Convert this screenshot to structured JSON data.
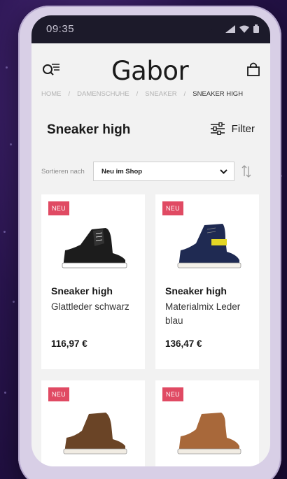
{
  "status_bar": {
    "time": "09:35"
  },
  "header": {
    "logo": "Gabor",
    "menu_icon": "search-menu-icon",
    "cart_icon": "shopping-bag-icon"
  },
  "breadcrumb": [
    "HOME",
    "DAMENSCHUHE",
    "SNEAKER",
    "SNEAKER HIGH"
  ],
  "page_title": "Sneaker high",
  "filter_label": "Filter",
  "sort": {
    "label": "Sortieren nach",
    "selected": "Neu im Shop"
  },
  "products": [
    {
      "badge": "NEU",
      "name": "Sneaker high",
      "desc": "Glattleder schwarz",
      "price": "116,97 €",
      "shoe_color": "#1c1c1c",
      "accent": "#ffffff"
    },
    {
      "badge": "NEU",
      "name": "Sneaker high",
      "desc": "Materialmix Leder blau",
      "price": "136,47 €",
      "shoe_color": "#1f2a52",
      "accent": "#e3d625"
    },
    {
      "badge": "NEU",
      "shoe_color": "#6a4426",
      "accent": "#f1ece3"
    },
    {
      "badge": "NEU",
      "shoe_color": "#a8683a",
      "accent": "#f1ece3"
    }
  ],
  "colors": {
    "badge": "#e04a63",
    "background": "#2a1550",
    "screen": "#f2f2f2"
  }
}
